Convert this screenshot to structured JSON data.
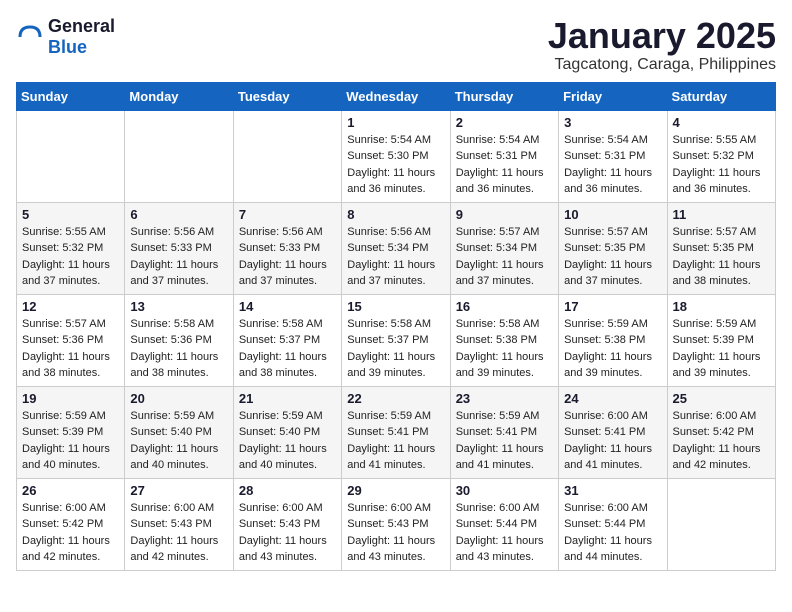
{
  "header": {
    "logo_general": "General",
    "logo_blue": "Blue",
    "month_title": "January 2025",
    "location": "Tagcatong, Caraga, Philippines"
  },
  "weekdays": [
    "Sunday",
    "Monday",
    "Tuesday",
    "Wednesday",
    "Thursday",
    "Friday",
    "Saturday"
  ],
  "weeks": [
    [
      {
        "day": "",
        "sunrise": "",
        "sunset": "",
        "daylight": ""
      },
      {
        "day": "",
        "sunrise": "",
        "sunset": "",
        "daylight": ""
      },
      {
        "day": "",
        "sunrise": "",
        "sunset": "",
        "daylight": ""
      },
      {
        "day": "1",
        "sunrise": "Sunrise: 5:54 AM",
        "sunset": "Sunset: 5:30 PM",
        "daylight": "Daylight: 11 hours and 36 minutes."
      },
      {
        "day": "2",
        "sunrise": "Sunrise: 5:54 AM",
        "sunset": "Sunset: 5:31 PM",
        "daylight": "Daylight: 11 hours and 36 minutes."
      },
      {
        "day": "3",
        "sunrise": "Sunrise: 5:54 AM",
        "sunset": "Sunset: 5:31 PM",
        "daylight": "Daylight: 11 hours and 36 minutes."
      },
      {
        "day": "4",
        "sunrise": "Sunrise: 5:55 AM",
        "sunset": "Sunset: 5:32 PM",
        "daylight": "Daylight: 11 hours and 36 minutes."
      }
    ],
    [
      {
        "day": "5",
        "sunrise": "Sunrise: 5:55 AM",
        "sunset": "Sunset: 5:32 PM",
        "daylight": "Daylight: 11 hours and 37 minutes."
      },
      {
        "day": "6",
        "sunrise": "Sunrise: 5:56 AM",
        "sunset": "Sunset: 5:33 PM",
        "daylight": "Daylight: 11 hours and 37 minutes."
      },
      {
        "day": "7",
        "sunrise": "Sunrise: 5:56 AM",
        "sunset": "Sunset: 5:33 PM",
        "daylight": "Daylight: 11 hours and 37 minutes."
      },
      {
        "day": "8",
        "sunrise": "Sunrise: 5:56 AM",
        "sunset": "Sunset: 5:34 PM",
        "daylight": "Daylight: 11 hours and 37 minutes."
      },
      {
        "day": "9",
        "sunrise": "Sunrise: 5:57 AM",
        "sunset": "Sunset: 5:34 PM",
        "daylight": "Daylight: 11 hours and 37 minutes."
      },
      {
        "day": "10",
        "sunrise": "Sunrise: 5:57 AM",
        "sunset": "Sunset: 5:35 PM",
        "daylight": "Daylight: 11 hours and 37 minutes."
      },
      {
        "day": "11",
        "sunrise": "Sunrise: 5:57 AM",
        "sunset": "Sunset: 5:35 PM",
        "daylight": "Daylight: 11 hours and 38 minutes."
      }
    ],
    [
      {
        "day": "12",
        "sunrise": "Sunrise: 5:57 AM",
        "sunset": "Sunset: 5:36 PM",
        "daylight": "Daylight: 11 hours and 38 minutes."
      },
      {
        "day": "13",
        "sunrise": "Sunrise: 5:58 AM",
        "sunset": "Sunset: 5:36 PM",
        "daylight": "Daylight: 11 hours and 38 minutes."
      },
      {
        "day": "14",
        "sunrise": "Sunrise: 5:58 AM",
        "sunset": "Sunset: 5:37 PM",
        "daylight": "Daylight: 11 hours and 38 minutes."
      },
      {
        "day": "15",
        "sunrise": "Sunrise: 5:58 AM",
        "sunset": "Sunset: 5:37 PM",
        "daylight": "Daylight: 11 hours and 39 minutes."
      },
      {
        "day": "16",
        "sunrise": "Sunrise: 5:58 AM",
        "sunset": "Sunset: 5:38 PM",
        "daylight": "Daylight: 11 hours and 39 minutes."
      },
      {
        "day": "17",
        "sunrise": "Sunrise: 5:59 AM",
        "sunset": "Sunset: 5:38 PM",
        "daylight": "Daylight: 11 hours and 39 minutes."
      },
      {
        "day": "18",
        "sunrise": "Sunrise: 5:59 AM",
        "sunset": "Sunset: 5:39 PM",
        "daylight": "Daylight: 11 hours and 39 minutes."
      }
    ],
    [
      {
        "day": "19",
        "sunrise": "Sunrise: 5:59 AM",
        "sunset": "Sunset: 5:39 PM",
        "daylight": "Daylight: 11 hours and 40 minutes."
      },
      {
        "day": "20",
        "sunrise": "Sunrise: 5:59 AM",
        "sunset": "Sunset: 5:40 PM",
        "daylight": "Daylight: 11 hours and 40 minutes."
      },
      {
        "day": "21",
        "sunrise": "Sunrise: 5:59 AM",
        "sunset": "Sunset: 5:40 PM",
        "daylight": "Daylight: 11 hours and 40 minutes."
      },
      {
        "day": "22",
        "sunrise": "Sunrise: 5:59 AM",
        "sunset": "Sunset: 5:41 PM",
        "daylight": "Daylight: 11 hours and 41 minutes."
      },
      {
        "day": "23",
        "sunrise": "Sunrise: 5:59 AM",
        "sunset": "Sunset: 5:41 PM",
        "daylight": "Daylight: 11 hours and 41 minutes."
      },
      {
        "day": "24",
        "sunrise": "Sunrise: 6:00 AM",
        "sunset": "Sunset: 5:41 PM",
        "daylight": "Daylight: 11 hours and 41 minutes."
      },
      {
        "day": "25",
        "sunrise": "Sunrise: 6:00 AM",
        "sunset": "Sunset: 5:42 PM",
        "daylight": "Daylight: 11 hours and 42 minutes."
      }
    ],
    [
      {
        "day": "26",
        "sunrise": "Sunrise: 6:00 AM",
        "sunset": "Sunset: 5:42 PM",
        "daylight": "Daylight: 11 hours and 42 minutes."
      },
      {
        "day": "27",
        "sunrise": "Sunrise: 6:00 AM",
        "sunset": "Sunset: 5:43 PM",
        "daylight": "Daylight: 11 hours and 42 minutes."
      },
      {
        "day": "28",
        "sunrise": "Sunrise: 6:00 AM",
        "sunset": "Sunset: 5:43 PM",
        "daylight": "Daylight: 11 hours and 43 minutes."
      },
      {
        "day": "29",
        "sunrise": "Sunrise: 6:00 AM",
        "sunset": "Sunset: 5:43 PM",
        "daylight": "Daylight: 11 hours and 43 minutes."
      },
      {
        "day": "30",
        "sunrise": "Sunrise: 6:00 AM",
        "sunset": "Sunset: 5:44 PM",
        "daylight": "Daylight: 11 hours and 43 minutes."
      },
      {
        "day": "31",
        "sunrise": "Sunrise: 6:00 AM",
        "sunset": "Sunset: 5:44 PM",
        "daylight": "Daylight: 11 hours and 44 minutes."
      },
      {
        "day": "",
        "sunrise": "",
        "sunset": "",
        "daylight": ""
      }
    ]
  ]
}
